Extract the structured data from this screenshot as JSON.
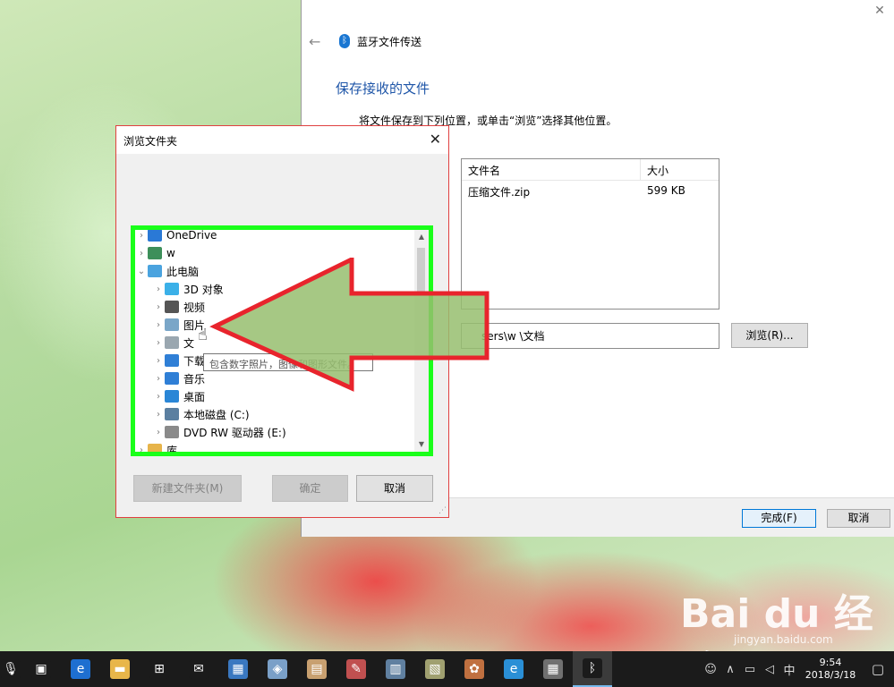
{
  "bt_window": {
    "title": "蓝牙文件传送",
    "heading": "保存接收的文件",
    "description": "将文件保存到下列位置，或单击“浏览”选择其他位置。",
    "table": {
      "col_name": "文件名",
      "col_size": "大小",
      "rows": [
        {
          "name": "压缩文件.zip",
          "size": "599 KB"
        }
      ]
    },
    "path": "sers\\w       \\文档",
    "browse_label": "浏览(R)...",
    "finish_label": "完成(F)",
    "cancel_label": "取消"
  },
  "dialog": {
    "title": "浏览文件夹",
    "tree": [
      {
        "label": "OneDrive",
        "icon": "cloud-icon",
        "color": "#2a79d6"
      },
      {
        "label": "w",
        "icon": "user-icon",
        "color": "#3d8f5a"
      },
      {
        "label": "此电脑",
        "icon": "computer-icon",
        "color": "#4aa3df"
      },
      {
        "label": "3D 对象",
        "icon": "cube-icon",
        "color": "#3bb0e8"
      },
      {
        "label": "视频",
        "icon": "film-icon",
        "color": "#555"
      },
      {
        "label": "图片",
        "icon": "picture-icon",
        "color": "#7aa6c8"
      },
      {
        "label": "文",
        "icon": "document-icon",
        "color": "#9aa7b0"
      },
      {
        "label": "下载",
        "icon": "download-icon",
        "color": "#2f7fd6"
      },
      {
        "label": "音乐",
        "icon": "music-icon",
        "color": "#2f7fd6"
      },
      {
        "label": "桌面",
        "icon": "desktop-icon",
        "color": "#2a86d6"
      },
      {
        "label": "本地磁盘 (C:)",
        "icon": "drive-icon",
        "color": "#5b7fa0"
      },
      {
        "label": "DVD RW 驱动器 (E:)",
        "icon": "dvd-icon",
        "color": "#8a8a8a"
      },
      {
        "label": "库",
        "icon": "library-icon",
        "color": "#e7b44a"
      }
    ],
    "tooltip": "包含数字照片，图像和图形文件。",
    "new_folder_label": "新建文件夹(M)",
    "ok_label": "确定",
    "cancel_label": "取消"
  },
  "watermark": {
    "brand": "Bai du 经验",
    "url": "jingyan.baidu.com"
  },
  "taskbar": {
    "icons": [
      "mic-icon",
      "task-view-icon",
      "edge-icon",
      "file-explorer-icon",
      "store-icon",
      "mail-icon",
      "remote-desktop-icon",
      "app-icon",
      "contacts-icon",
      "paint-icon",
      "media-icon",
      "notes-icon",
      "palette-icon",
      "ie-icon",
      "calculator-icon",
      "bluetooth-icon"
    ],
    "ime": "中",
    "time": "9:54",
    "date": "2018/3/18"
  }
}
